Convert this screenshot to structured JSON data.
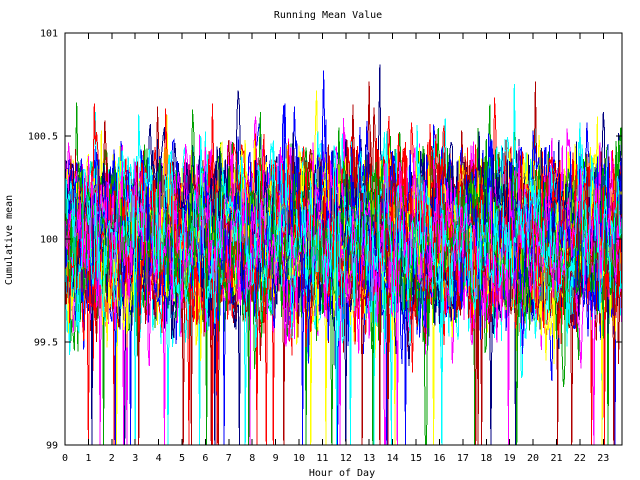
{
  "chart_data": {
    "type": "line",
    "title": "Running Mean Value",
    "xlabel": "Hour of Day",
    "ylabel": "Cumulative mean",
    "xlim": [
      0,
      23.8
    ],
    "ylim": [
      99,
      101
    ],
    "x_ticks": [
      "0",
      "1",
      "2",
      "3",
      "4",
      "5",
      "6",
      "7",
      "8",
      "9",
      "10",
      "11",
      "12",
      "13",
      "14",
      "15",
      "16",
      "17",
      "18",
      "19",
      "20",
      "21",
      "22",
      "23"
    ],
    "y_ticks": [
      "99",
      "99.5",
      "100",
      "100.5",
      "101"
    ],
    "grid": false,
    "legend": "none",
    "series_colors": [
      "#0000ff",
      "#ff0000",
      "#00a000",
      "#ff00ff",
      "#00ffff",
      "#ffff00",
      "#b00000",
      "#000080"
    ],
    "num_series": 45,
    "center_value": 100,
    "typical_band": [
      99.6,
      100.4
    ],
    "extreme_range": [
      99,
      100.87
    ]
  }
}
